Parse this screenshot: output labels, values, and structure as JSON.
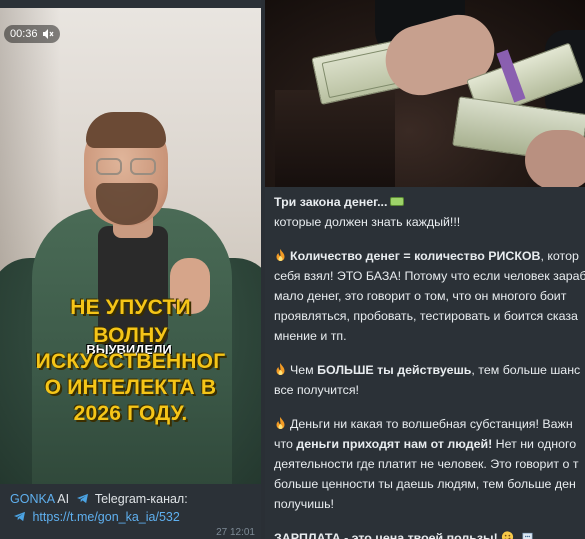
{
  "left_message": {
    "video": {
      "duration": "00:36",
      "overlay_lines": [
        "НЕ УПУСТИ",
        "ВОЛНУ",
        "ИСКУССТВЕННОГ",
        "О ИНТЕЛЕКТА В",
        "2026 ГОДУ."
      ],
      "caption": "ВЫУВИДЕЛИ"
    },
    "sender": "GONKA",
    "sender_suffix": "AI",
    "channel_label": "Telegram-канал:",
    "link": "https://t.me/gon_ka_ia/532",
    "time_partial": "27 12:01"
  },
  "right_message": {
    "title": "Три закона денег...",
    "subtitle": "которые должен знать каждый!!!",
    "line1_bold": "Количество денег = количество РИСКОВ",
    "line1_rest": ", котор",
    "line2": "себя взял! ЭТО БАЗА! Потому что если человек зараб",
    "line3": "мало денег, это говорит о том, что он многого боит",
    "line4": "проявляться, пробовать, тестировать и боится сказа",
    "line5": "мнение и тп.",
    "p2_prefix": "Чем ",
    "p2_bold": "БОЛЬШЕ ты действуешь",
    "p2_rest": ", тем больше шанс",
    "p2_line2": "все получится!",
    "p3_line1": "Деньги ни какая то волшебная субстанция! Важн",
    "p3_prefix": "что ",
    "p3_bold": "деньги приходят нам от людей!",
    "p3_rest": " Нет ни одного",
    "p3_line3": "деятельности где платит не человек. Это говорит о т",
    "p3_line4": "больше ценности ты даешь людям, тем больше ден",
    "p3_line5": "получишь!",
    "p4_bold": "ЗАРПЛАТА - это цена твоей пользы!"
  },
  "colors": {
    "background": "#2b3137",
    "link": "#5fb0ef",
    "overlay_yellow": "#f5c518",
    "text": "#e8ecef"
  }
}
